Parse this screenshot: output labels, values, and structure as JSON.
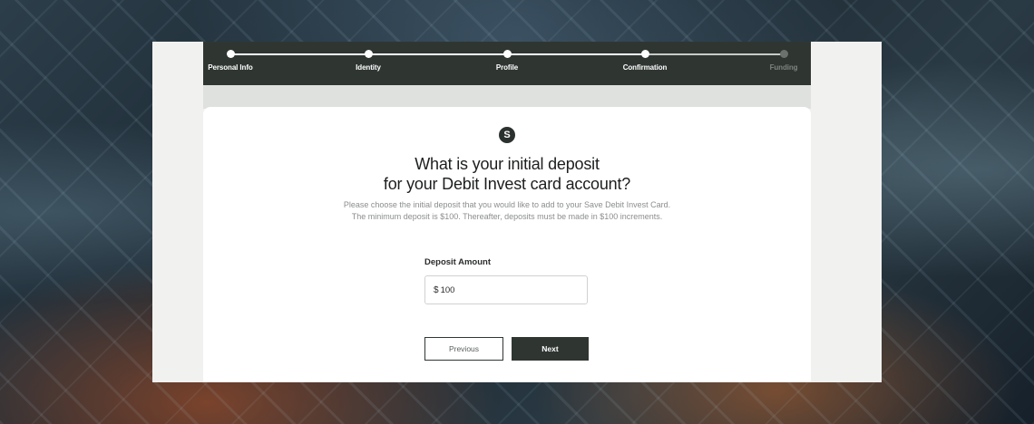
{
  "progress": {
    "steps": [
      {
        "label": "Personal Info",
        "done": true
      },
      {
        "label": "Identity",
        "done": true
      },
      {
        "label": "Profile",
        "done": true
      },
      {
        "label": "Confirmation",
        "done": true
      },
      {
        "label": "Funding",
        "done": false
      }
    ]
  },
  "logo": {
    "letter": "S"
  },
  "main": {
    "heading_line1": "What is your initial deposit",
    "heading_line2": "for your Debit Invest card account?",
    "subtext_line1": "Please choose the initial deposit that you would like to add to your Save Debit Invest Card.",
    "subtext_line2": "The minimum deposit is $100. Thereafter, deposits must be made in $100 increments."
  },
  "form": {
    "deposit_label": "Deposit Amount",
    "currency_prefix": "$",
    "deposit_value": "100"
  },
  "buttons": {
    "previous_label": "Previous",
    "next_label": "Next"
  },
  "colors": {
    "primary_dark": "#2f3632",
    "background_frame": "#f1f1f0"
  }
}
